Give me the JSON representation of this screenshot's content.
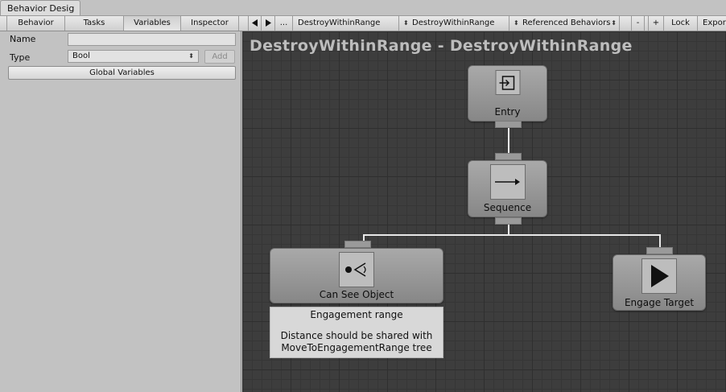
{
  "window": {
    "tab_title": "Behavior Desig"
  },
  "toolbar": {
    "tabs": [
      {
        "label": "Behavior"
      },
      {
        "label": "Tasks"
      },
      {
        "label": "Variables",
        "active": true
      },
      {
        "label": "Inspector"
      }
    ],
    "back_icon": "triangle-left-icon",
    "forward_icon": "triangle-right-icon",
    "more_label": "...",
    "behavior_select": "DestroyWithinRange",
    "tree_select": "DestroyWithinRange",
    "referenced_select": "Referenced Behaviors",
    "minus_label": "-",
    "plus_label": "+",
    "lock_label": "Lock",
    "export_label": "Expor"
  },
  "variables_panel": {
    "name_label": "Name",
    "name_value": "",
    "type_label": "Type",
    "type_value": "Bool",
    "add_label": "Add",
    "global_variables_label": "Global Variables"
  },
  "graph": {
    "title": "DestroyWithinRange - DestroyWithinRange",
    "nodes": [
      {
        "label": "Entry",
        "icon": "entry-icon"
      },
      {
        "label": "Sequence",
        "icon": "arrow-right-icon"
      },
      {
        "label": "Can See Object",
        "icon": "eye-sight-icon"
      },
      {
        "label": "Engage Target",
        "icon": "play-icon"
      }
    ],
    "comment": {
      "title": "Engagement range",
      "line1": "Distance should be shared with",
      "line2": "MoveToEngagementRange tree"
    }
  },
  "colors": {
    "graph_background": "#3d3d3d",
    "node_fill": "#9a9a9a",
    "connection": "#e8e8e8",
    "panel_background": "#c2c2c2"
  }
}
